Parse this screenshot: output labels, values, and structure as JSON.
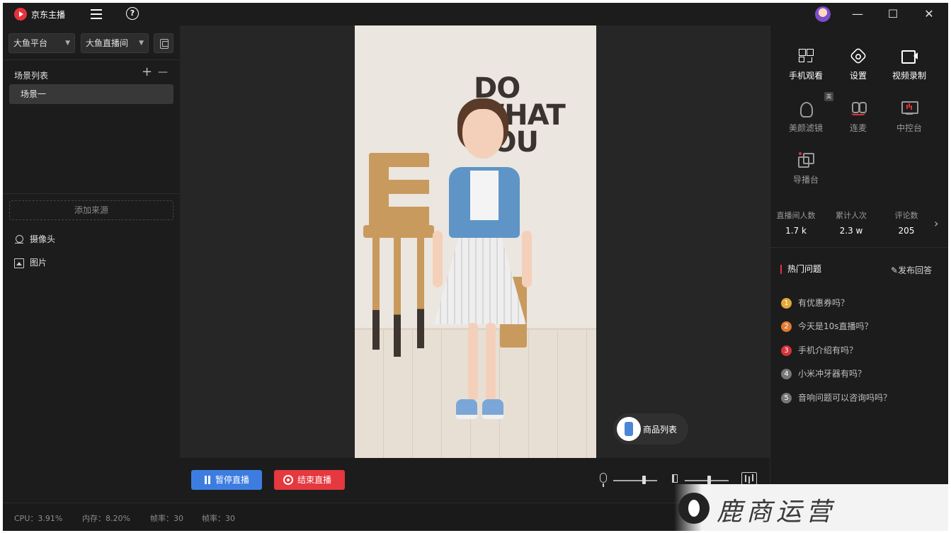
{
  "app": {
    "title": "京东主播"
  },
  "window_controls": {
    "minimize": "—",
    "maximize": "☐",
    "close": "✕"
  },
  "left": {
    "platform_select": "大鱼平台",
    "room_select": "大鱼直播间",
    "scene_list_title": "场景列表",
    "add_scene": "+",
    "remove_scene": "—",
    "scenes": [
      "场景一"
    ],
    "add_source": "添加来源",
    "sources": [
      {
        "label": "摄像头",
        "icon": "camera-icon"
      },
      {
        "label": "图片",
        "icon": "image-icon"
      }
    ]
  },
  "preview": {
    "poster_text": "DO WHAT YOU",
    "product_list": "商品列表"
  },
  "controls": {
    "pause_live": "暂停直播",
    "end_live": "结束直播",
    "mic_level": 0.7,
    "speaker_level": 0.55
  },
  "status": {
    "cpu": "CPU：3.91%",
    "memory": "内存：8.20%",
    "fps1": "帧率：30",
    "fps2": "帧率：30"
  },
  "watermark": {
    "text": "鹿商运营"
  },
  "right": {
    "tools": [
      {
        "label": "手机观看",
        "icon": "qr-code-icon"
      },
      {
        "label": "设置",
        "icon": "settings-icon"
      },
      {
        "label": "视频录制",
        "icon": "video-record-icon"
      },
      {
        "label": "美颜滤镜",
        "icon": "beauty-filter-icon"
      },
      {
        "label": "连麦",
        "icon": "co-host-icon"
      },
      {
        "label": "中控台",
        "icon": "console-icon"
      },
      {
        "label": "导播台",
        "icon": "director-icon"
      }
    ],
    "beauty_badge": "美",
    "stats": [
      {
        "label": "直播间人数",
        "value": "1.7 k"
      },
      {
        "label": "累计人次",
        "value": "2.3 w"
      },
      {
        "label": "评论数",
        "value": "205"
      }
    ],
    "stats_more": "›",
    "hot_questions_title": "热门问题",
    "publish_reply": "发布回答",
    "questions": [
      {
        "num": "1",
        "text": "有优惠券吗？",
        "color": "#e5a83a"
      },
      {
        "num": "2",
        "text": "今天是10s直播吗？",
        "color": "#e07a32"
      },
      {
        "num": "3",
        "text": "手机介绍有吗？",
        "color": "#d6333b"
      },
      {
        "num": "4",
        "text": "小米冲牙器有吗？",
        "color": "#777777"
      },
      {
        "num": "5",
        "text": "音响问题可以咨询吗吗？",
        "color": "#777777"
      }
    ]
  }
}
